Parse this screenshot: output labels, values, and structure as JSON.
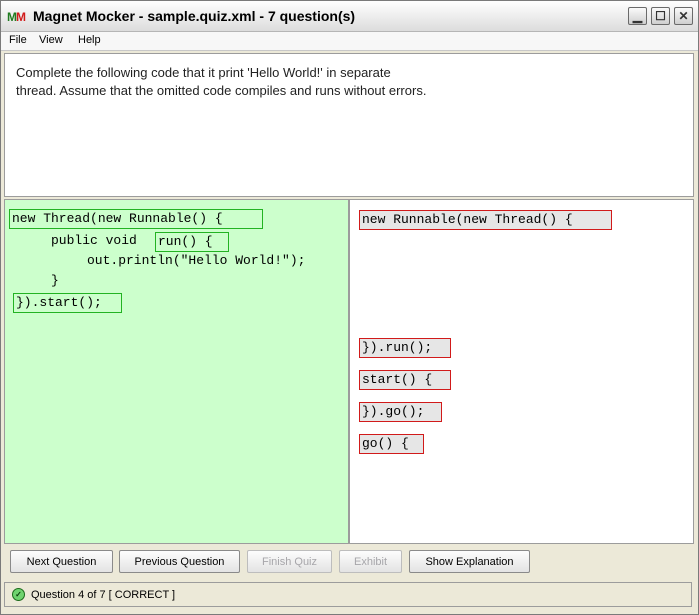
{
  "window": {
    "logo_text_1": "M",
    "logo_text_2": "M",
    "title": "Magnet Mocker - sample.quiz.xml - 7 question(s)",
    "minimize_glyph": "▁",
    "maximize_glyph": "☐",
    "close_glyph": "✕"
  },
  "menu": {
    "items": [
      "File",
      "View",
      "Help"
    ]
  },
  "question": {
    "line1": "Complete the following code that it print 'Hello World!' in separate",
    "line2": "thread. Assume that the omitted code compiles and runs without errors."
  },
  "answer_area": {
    "magnet_1": "new Thread(new Runnable() {",
    "static_1": "public void",
    "magnet_2": "run() {",
    "static_2": "out.println(\"Hello World!\");",
    "static_3": "}",
    "magnet_3": "}).start();"
  },
  "distractors": [
    "new Runnable(new Thread() {",
    "}).run();",
    "start() {",
    "}).go();",
    "go() {"
  ],
  "buttons": {
    "next": "Next Question",
    "previous": "Previous Question",
    "finish": "Finish Quiz",
    "exhibit": "Exhibit",
    "explanation": "Show Explanation"
  },
  "status": {
    "text": "Question 4 of 7 [ CORRECT ]",
    "icon": "correct-status-icon"
  },
  "colors": {
    "answer_bg": "#ccffcc",
    "correct_border": "#22b322",
    "distractor_border": "#d11a1a"
  }
}
